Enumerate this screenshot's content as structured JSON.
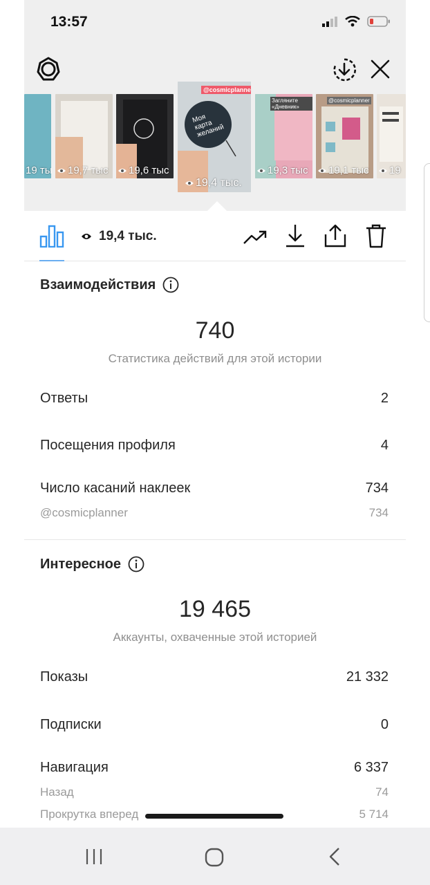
{
  "status": {
    "time": "13:57"
  },
  "thumbnails": [
    {
      "views": "19 тыс",
      "color": "#6fb4c2"
    },
    {
      "views": "19,7 тыс",
      "color": "#d9d4cc"
    },
    {
      "views": "19,6 тыс",
      "color": "#2d2d2f"
    },
    {
      "views": "19,4 тыс.",
      "color": "#28333c",
      "tag": "@cosmicplanner",
      "cover_text": "Моя карта желаний",
      "active": true
    },
    {
      "views": "19,3 тыс",
      "color": "#e8a8b8",
      "tag": "Загляните «Дневник»"
    },
    {
      "views": "19,1 тыс",
      "color": "#b89c86",
      "tag": "@cosmicplanner"
    },
    {
      "views": "19",
      "color": "#e9e3db"
    }
  ],
  "toolbar": {
    "views": "19,4 тыс."
  },
  "interactions": {
    "title": "Взаимодействия",
    "total": "740",
    "caption": "Статистика действий для этой истории",
    "rows": [
      {
        "label": "Ответы",
        "value": "2"
      },
      {
        "label": "Посещения профиля",
        "value": "4"
      },
      {
        "label": "Число касаний наклеек",
        "value": "734"
      }
    ],
    "sub": {
      "label": "@cosmicplanner",
      "value": "734"
    }
  },
  "discovery": {
    "title": "Интересное",
    "total": "19 465",
    "caption": "Аккаунты, охваченные этой историей",
    "rows": [
      {
        "label": "Показы",
        "value": "21 332"
      },
      {
        "label": "Подписки",
        "value": "0"
      },
      {
        "label": "Навигация",
        "value": "6 337"
      }
    ],
    "subs": [
      {
        "label": "Назад",
        "value": "74"
      },
      {
        "label": "Прокрутка вперед",
        "value": "5 714"
      }
    ]
  },
  "colors": {
    "accent": "#3897f0",
    "battery": "#e0413a"
  }
}
